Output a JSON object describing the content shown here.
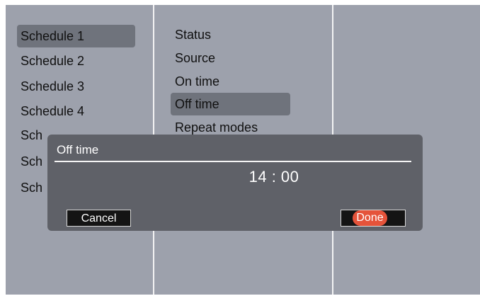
{
  "schedules": [
    {
      "label": "Schedule 1",
      "selected": true
    },
    {
      "label": "Schedule 2",
      "selected": false
    },
    {
      "label": "Schedule 3",
      "selected": false
    },
    {
      "label": "Schedule 4",
      "selected": false
    },
    {
      "label": "Sch",
      "selected": false
    },
    {
      "label": "Sch",
      "selected": false
    },
    {
      "label": "Sch",
      "selected": false
    }
  ],
  "settings": [
    {
      "label": "Status",
      "selected": false
    },
    {
      "label": "Source",
      "selected": false
    },
    {
      "label": "On time",
      "selected": false
    },
    {
      "label": "Off time",
      "selected": true
    },
    {
      "label": "Repeat modes",
      "selected": false
    }
  ],
  "dialog": {
    "title": "Off time",
    "time": "14 : 00",
    "cancel_label": "Cancel",
    "done_label": "Done"
  },
  "colors": {
    "background": "#9da1ac",
    "selection": "#6f737c",
    "dialog": "#5f6168",
    "done_accent": "#e5533a"
  }
}
